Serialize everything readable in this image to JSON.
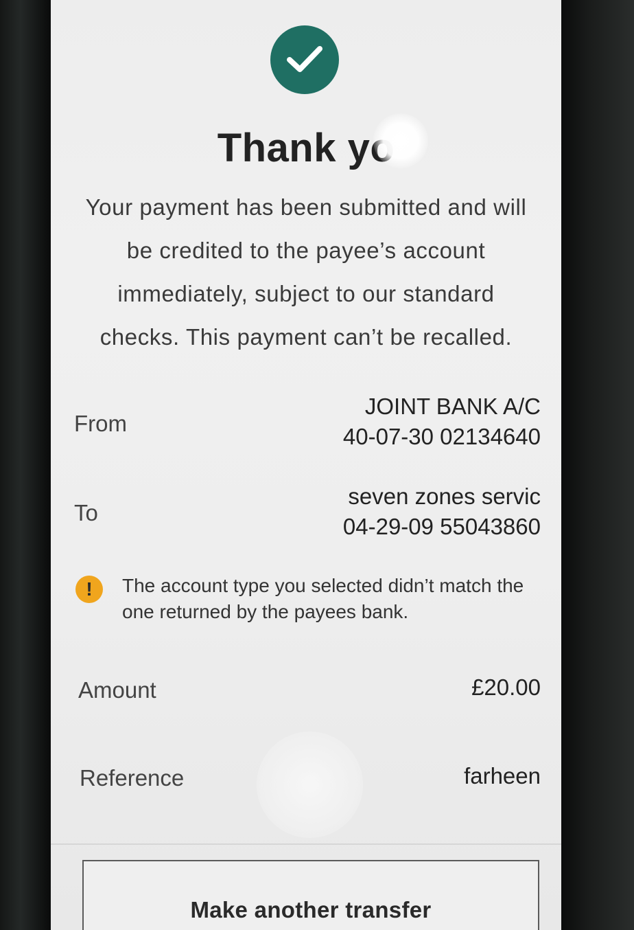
{
  "header": {
    "status_icon": "check-icon",
    "title": "Thank yo",
    "message": "Your payment has been submitted and will be credited to the payee’s account immediately, subject to our standard checks. This payment can’t be recalled."
  },
  "details": {
    "from": {
      "label": "From",
      "name": "JOINT BANK A/C",
      "account": "40-07-30 02134640"
    },
    "to": {
      "label": "To",
      "name": "seven zones servic",
      "account": "04-29-09 55043860"
    },
    "warning": {
      "icon": "warning-icon",
      "text": "The account type you selected didn’t match the one returned by the payees bank."
    },
    "amount": {
      "label": "Amount",
      "value": "£20.00"
    },
    "reference": {
      "label": "Reference",
      "value": "farheen"
    }
  },
  "actions": {
    "make_another_label": "Make another transfer"
  },
  "colors": {
    "success": "#1f6f63",
    "warning": "#f0a51d"
  }
}
